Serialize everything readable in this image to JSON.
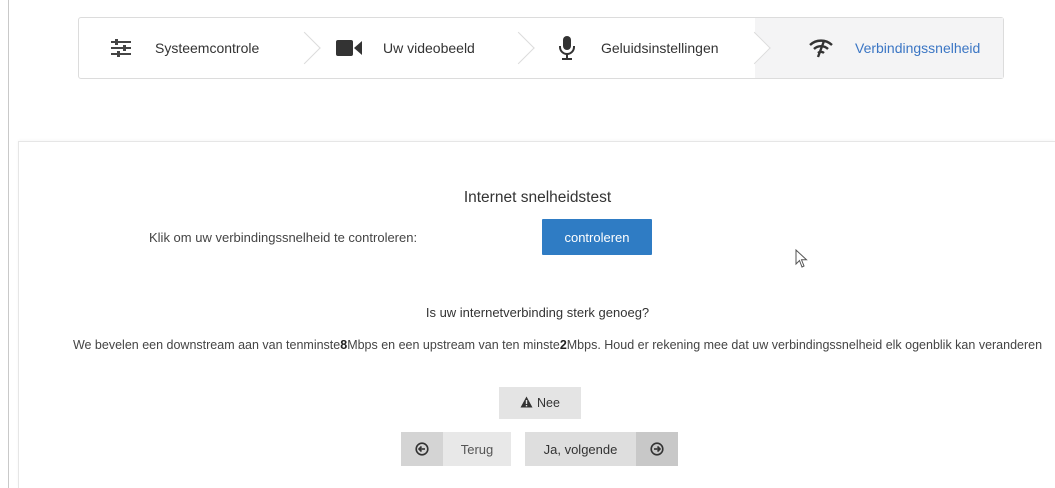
{
  "stepper": {
    "steps": [
      {
        "label": "Systeemcontrole",
        "icon": "sliders-icon"
      },
      {
        "label": "Uw videobeeld",
        "icon": "video-camera-icon"
      },
      {
        "label": "Geluidsinstellingen",
        "icon": "microphone-icon"
      },
      {
        "label": "Verbindingssnelheid",
        "icon": "wifi-icon",
        "active": true
      }
    ]
  },
  "speedtest": {
    "title": "Internet snelheidstest",
    "prompt": "Klik om uw verbindingssnelheid te controleren:",
    "button_label": "controleren"
  },
  "advice": {
    "question": "Is uw internetverbinding sterk genoeg?",
    "text_1": "We bevelen een downstream aan van tenminste",
    "downstream": "8",
    "text_2": "Mbps en een upstream van ten minste",
    "upstream": "2",
    "text_3": "Mbps. Houd er rekening mee dat uw verbindingssnelheid elk ogenblik kan veranderen"
  },
  "buttons": {
    "nee_label": "Nee",
    "back_label": "Terug",
    "next_label": "Ja, volgende"
  },
  "colors": {
    "accent": "#2f7cc4",
    "active_step_text": "#3b76c4",
    "active_step_bg": "#f4f4f5"
  }
}
